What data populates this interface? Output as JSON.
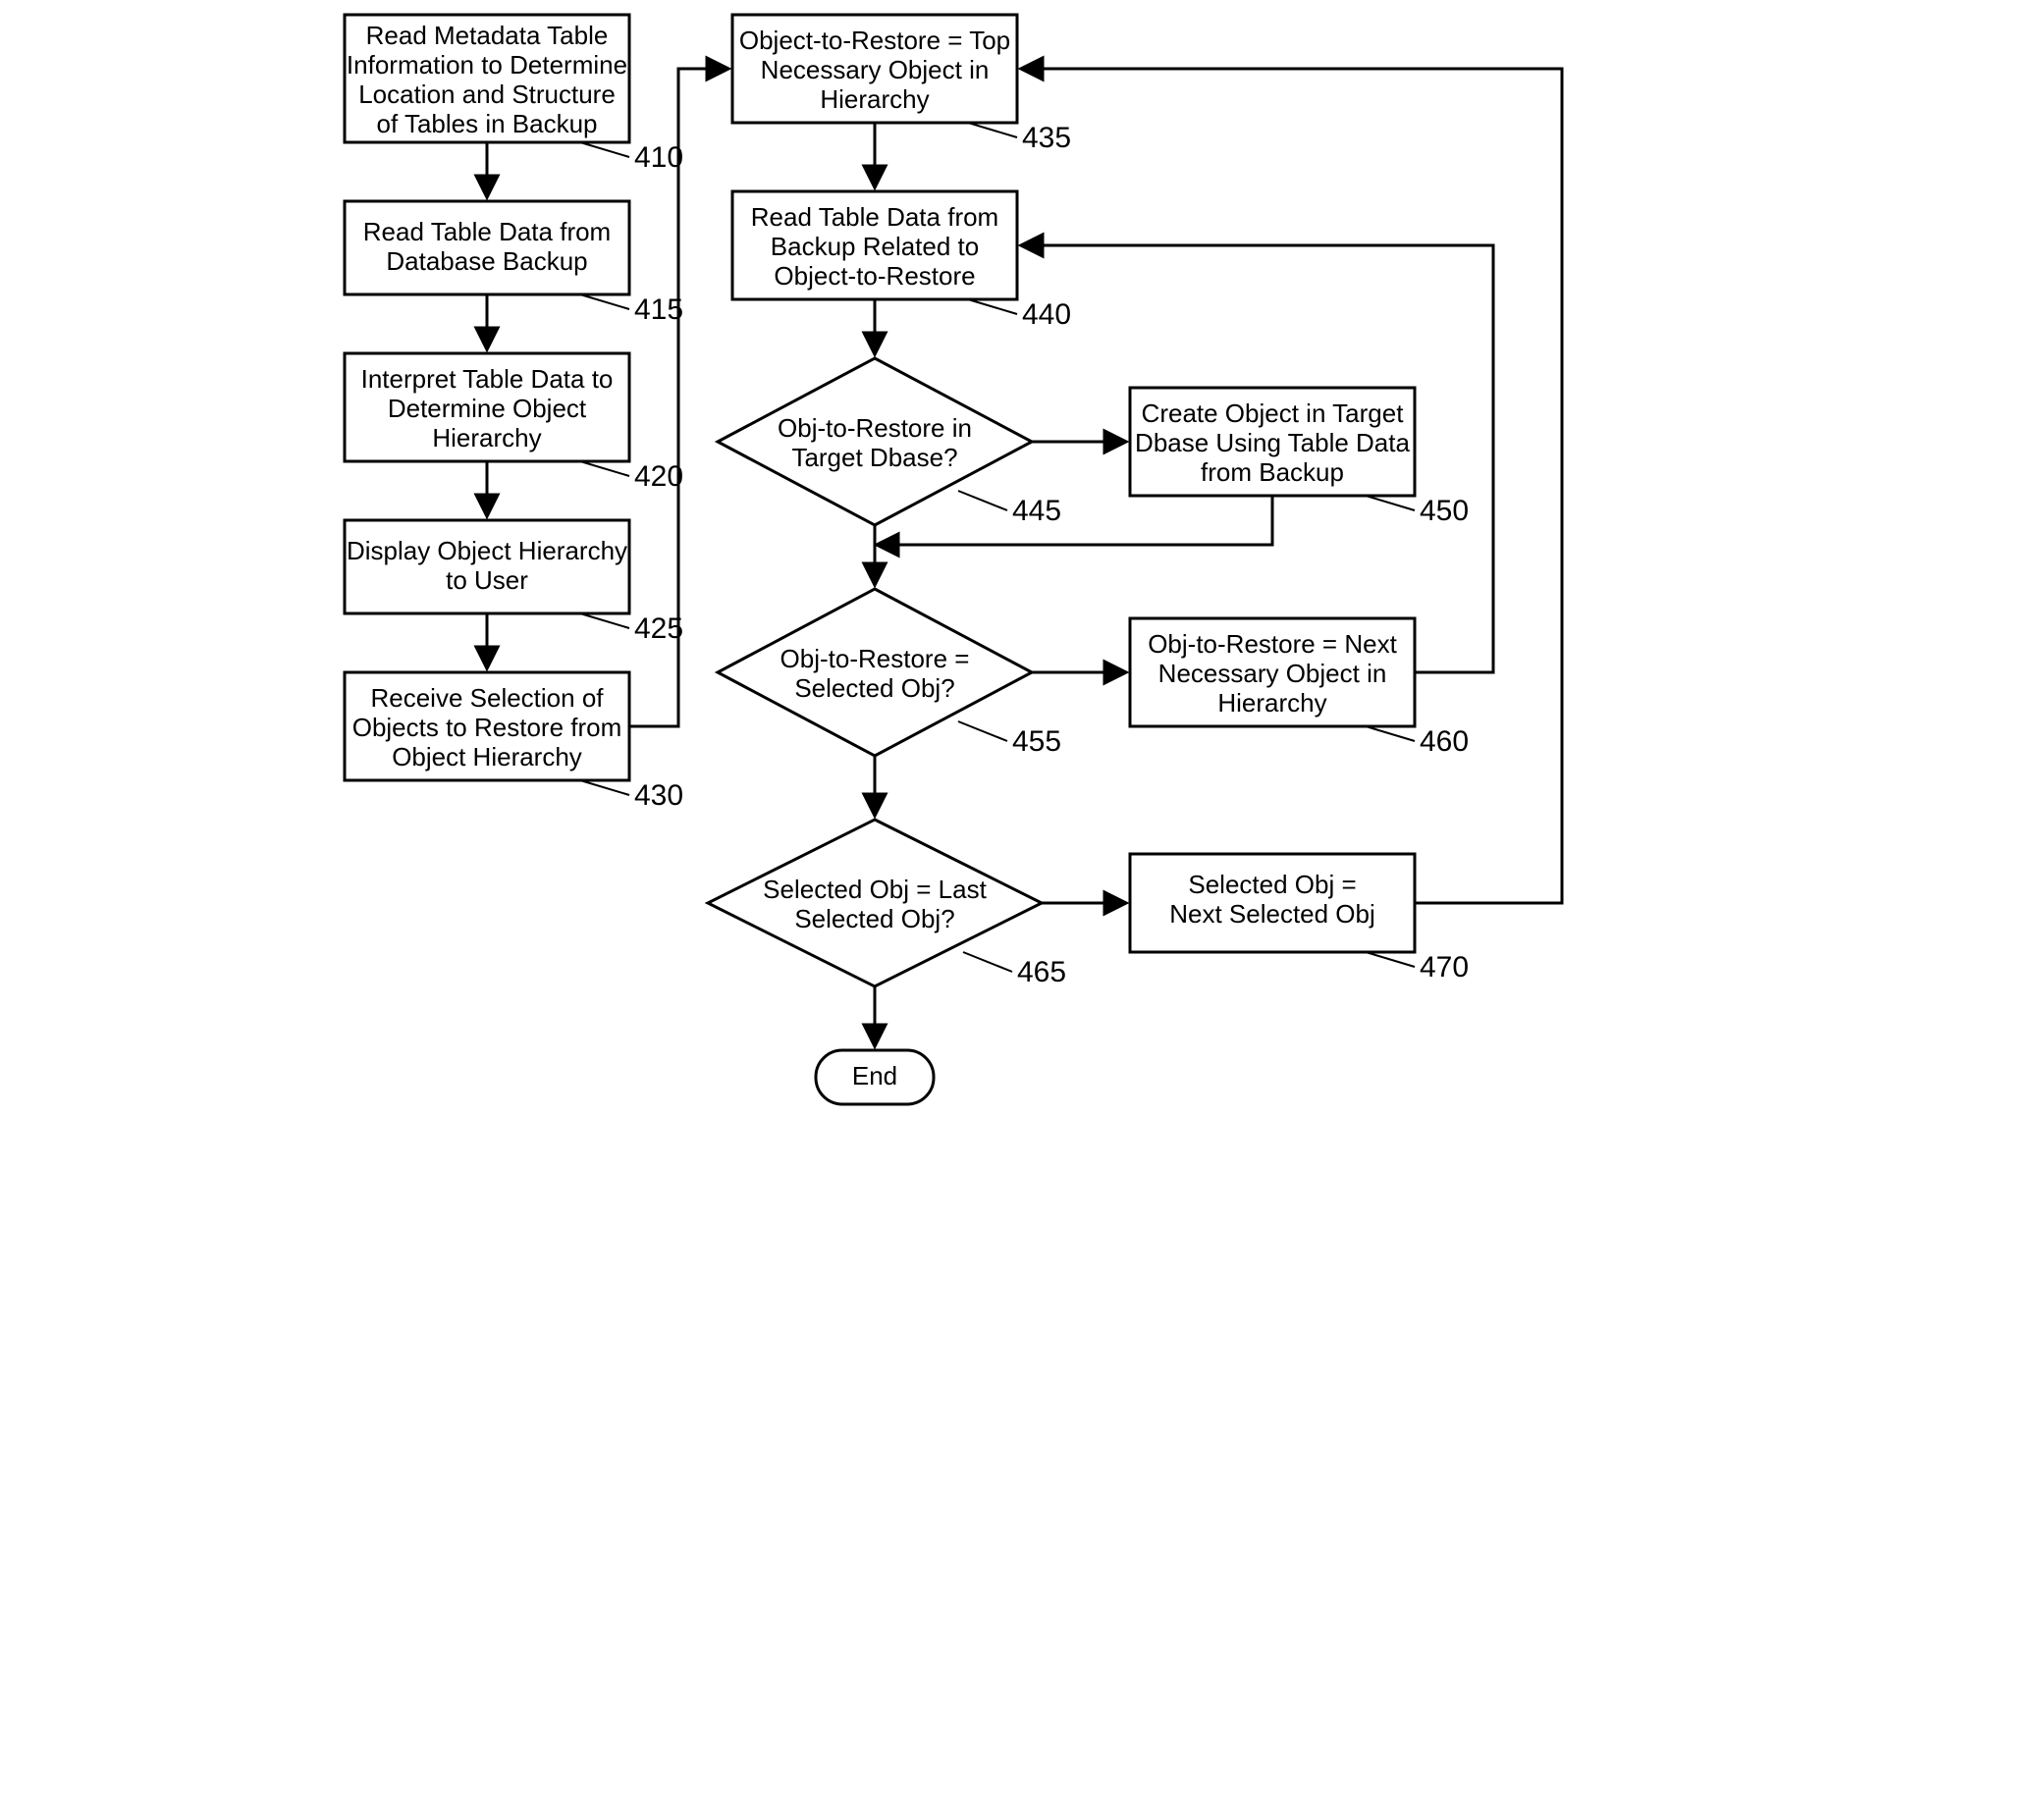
{
  "nodes": {
    "b410": [
      "Read Metadata Table",
      "Information to Determine",
      "Location and Structure",
      "of Tables in Backup"
    ],
    "b415": [
      "Read Table Data from",
      "Database Backup"
    ],
    "b420": [
      "Interpret Table Data to",
      "Determine Object",
      "Hierarchy"
    ],
    "b425": [
      "Display Object Hierarchy",
      "to User"
    ],
    "b430": [
      "Receive Selection of",
      "Objects to Restore from",
      "Object Hierarchy"
    ],
    "b435": [
      "Object-to-Restore = Top",
      "Necessary Object in",
      "Hierarchy"
    ],
    "b440": [
      "Read Table Data from",
      "Backup Related to",
      "Object-to-Restore"
    ],
    "d445": [
      "Obj-to-Restore in",
      "Target Dbase?"
    ],
    "b450": [
      "Create Object in Target",
      "Dbase Using Table Data",
      "from Backup"
    ],
    "d455": [
      "Obj-to-Restore =",
      "Selected Obj?"
    ],
    "b460": [
      "Obj-to-Restore = Next",
      "Necessary Object in",
      "Hierarchy"
    ],
    "d465": [
      "Selected Obj = Last",
      "Selected Obj?"
    ],
    "b470": [
      "Selected Obj =",
      "Next Selected Obj"
    ],
    "end": "End"
  },
  "refs": {
    "r410": "410",
    "r415": "415",
    "r420": "420",
    "r425": "425",
    "r430": "430",
    "r435": "435",
    "r440": "440",
    "r445": "445",
    "r450": "450",
    "r455": "455",
    "r460": "460",
    "r465": "465",
    "r470": "470"
  }
}
